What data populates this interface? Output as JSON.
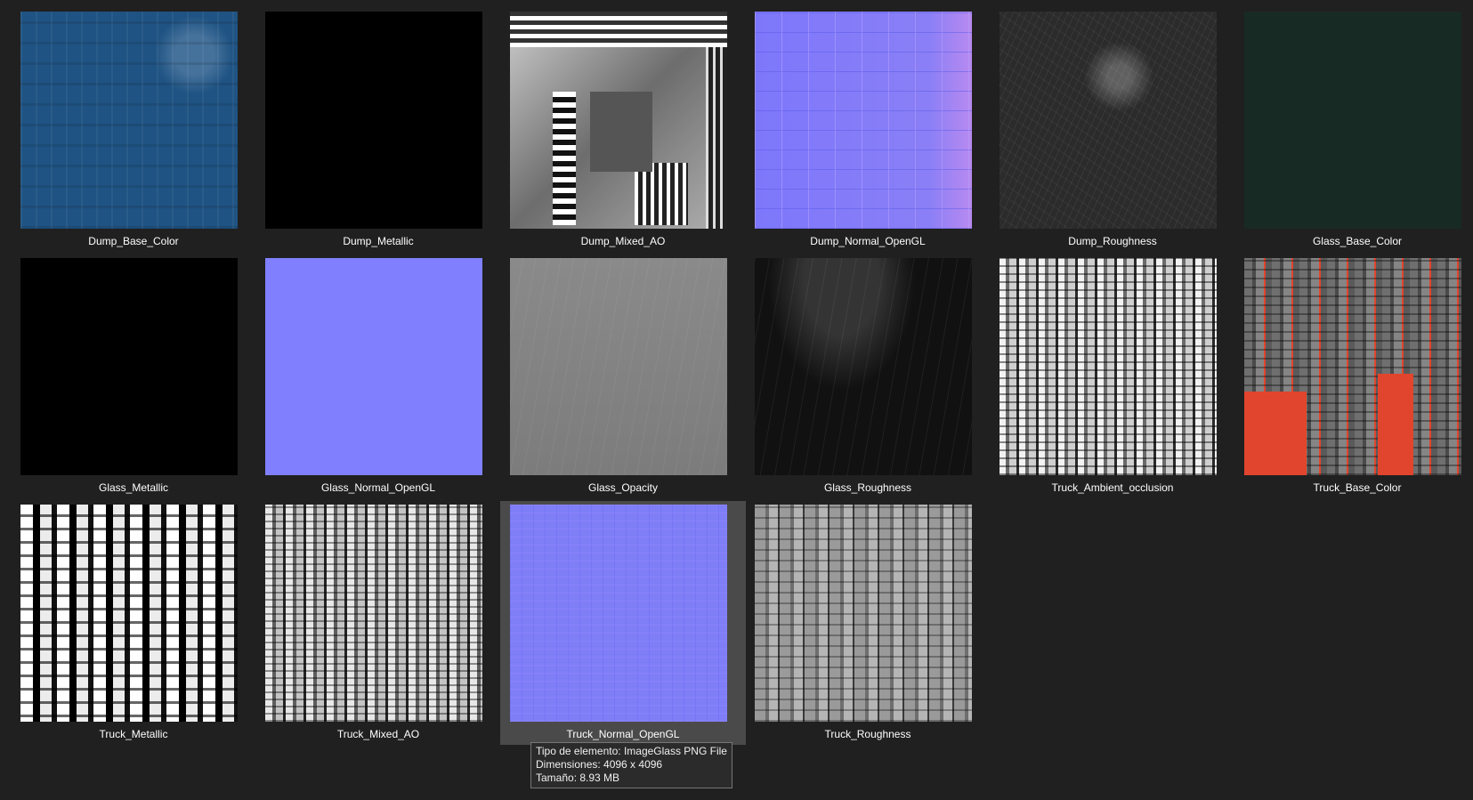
{
  "files": [
    {
      "name": "Dump_Base_Color",
      "thumbnail": "blue-scratched-paint-texture"
    },
    {
      "name": "Dump_Metallic",
      "thumbnail": "solid-black-texture"
    },
    {
      "name": "Dump_Mixed_AO",
      "thumbnail": "grayscale-ao-texture"
    },
    {
      "name": "Dump_Normal_OpenGL",
      "thumbnail": "normal-map-texture"
    },
    {
      "name": "Dump_Roughness",
      "thumbnail": "dark-grunge-texture"
    },
    {
      "name": "Glass_Base_Color",
      "thumbnail": "dark-green-texture"
    },
    {
      "name": "Glass_Metallic",
      "thumbnail": "solid-black-texture"
    },
    {
      "name": "Glass_Normal_OpenGL",
      "thumbnail": "flat-normal-map-texture"
    },
    {
      "name": "Glass_Opacity",
      "thumbnail": "gray-opacity-texture"
    },
    {
      "name": "Glass_Roughness",
      "thumbnail": "dark-roughness-texture"
    },
    {
      "name": "Truck_Ambient_occlusion",
      "thumbnail": "truck-ao-texture"
    },
    {
      "name": "Truck_Base_Color",
      "thumbnail": "truck-red-gray-texture"
    },
    {
      "name": "Truck_Metallic",
      "thumbnail": "black-white-metallic-texture"
    },
    {
      "name": "Truck_Mixed_AO",
      "thumbnail": "truck-mixed-ao-texture"
    },
    {
      "name": "Truck_Normal_OpenGL",
      "thumbnail": "truck-normal-map-texture"
    },
    {
      "name": "Truck_Roughness",
      "thumbnail": "truck-roughness-texture"
    }
  ],
  "selected_index": 14,
  "tooltip": {
    "type_line": "Tipo de elemento: ImageGlass PNG File",
    "dimensions_line": "Dimensiones: 4096 x 4096",
    "size_line": "Tamaño: 8.93 MB"
  },
  "colors": {
    "background": "#202020",
    "selection": "#4a4a4a",
    "label_text": "#ffffff"
  }
}
